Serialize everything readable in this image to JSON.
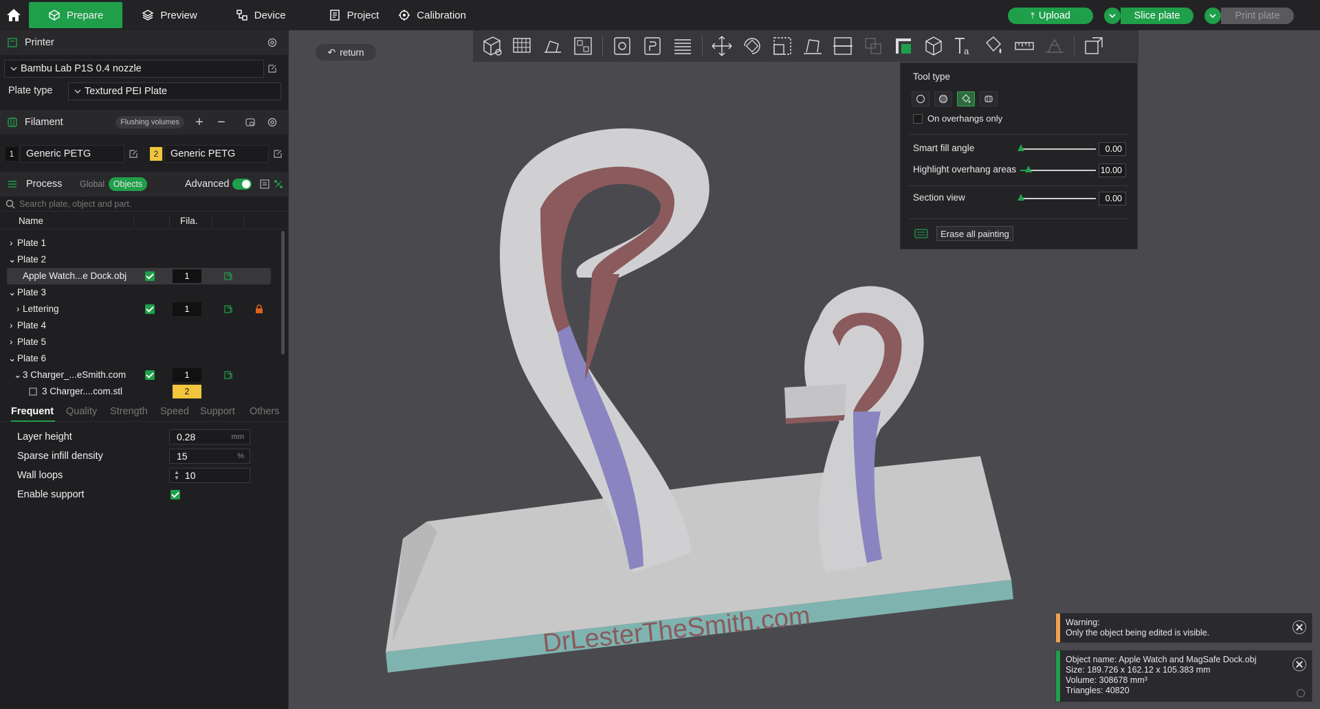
{
  "topbar": {
    "tabs": [
      {
        "label": "Prepare",
        "icon": "cube-icon",
        "active": true
      },
      {
        "label": "Preview",
        "icon": "layers-icon",
        "active": false
      },
      {
        "label": "Device",
        "icon": "device-icon",
        "active": false
      },
      {
        "label": "Project",
        "icon": "project-icon",
        "active": false
      },
      {
        "label": "Calibration",
        "icon": "calibration-icon",
        "active": false
      }
    ],
    "upload_label": "Upload",
    "slice_label": "Slice plate",
    "print_label": "Print plate"
  },
  "printer": {
    "section_title": "Printer",
    "printer_name": "Bambu Lab P1S 0.4 nozzle",
    "plate_type_label": "Plate type",
    "plate_type_value": "Textured PEI Plate"
  },
  "filament": {
    "section_title": "Filament",
    "flushing_label": "Flushing volumes",
    "items": [
      {
        "index": "1",
        "name": "Generic PETG",
        "color": "#111111"
      },
      {
        "index": "2",
        "name": "Generic PETG",
        "color": "#f2c53d"
      }
    ]
  },
  "process": {
    "section_title": "Process",
    "global_label": "Global",
    "objects_label": "Objects",
    "advanced_label": "Advanced",
    "search_placeholder": "Search plate, object and part.",
    "columns": {
      "name": "Name",
      "fila": "Fila."
    },
    "tree": [
      {
        "label": "Plate 1",
        "expand": "›"
      },
      {
        "label": "Plate 2",
        "expand": "⌄"
      },
      {
        "label": "Apple Watch...e Dock.obj",
        "fila": "1"
      },
      {
        "label": "Plate 3",
        "expand": "⌄"
      },
      {
        "label": "Lettering",
        "expand": "›",
        "fila": "1"
      },
      {
        "label": "Plate 4",
        "expand": "›"
      },
      {
        "label": "Plate 5",
        "expand": "›"
      },
      {
        "label": "Plate 6",
        "expand": "⌄"
      },
      {
        "label": "3 Charger_...eSmith.com",
        "expand": "⌄",
        "fila": "1"
      },
      {
        "label": "3 Charger....com.stl",
        "fila": "2"
      }
    ],
    "tabs": [
      "Frequent",
      "Quality",
      "Strength",
      "Speed",
      "Support",
      "Others"
    ],
    "params": [
      {
        "label": "Layer height",
        "value": "0.28",
        "unit": "mm"
      },
      {
        "label": "Sparse infill density",
        "value": "15",
        "unit": "%"
      },
      {
        "label": "Wall loops",
        "value": "10",
        "unit": ""
      },
      {
        "label": "Enable support",
        "value": "",
        "unit": ""
      }
    ]
  },
  "viewport": {
    "return_label": "return",
    "model_text": "DrLesterTheSmith.com"
  },
  "paint_panel": {
    "tool_type_label": "Tool type",
    "overhangs_only_label": "On overhangs only",
    "smart_fill_label": "Smart fill angle",
    "smart_fill_value": "0.00",
    "highlight_label": "Highlight overhang areas",
    "highlight_value": "10.00",
    "section_view_label": "Section view",
    "section_view_value": "0.00",
    "erase_label": "Erase all painting"
  },
  "notices": {
    "warning_title": "Warning:",
    "warning_text": "Only the object being edited is visible.",
    "object_name": "Object name: Apple Watch and MagSafe Dock.obj",
    "size": "Size: 189.726 x 162.12 x 105.383 mm",
    "volume": "Volume: 308678 mm³",
    "triangles": "Triangles: 40820"
  },
  "colors": {
    "accent": "#1f9f4a",
    "warning": "#f0a050",
    "info": "#1f9f4a"
  }
}
